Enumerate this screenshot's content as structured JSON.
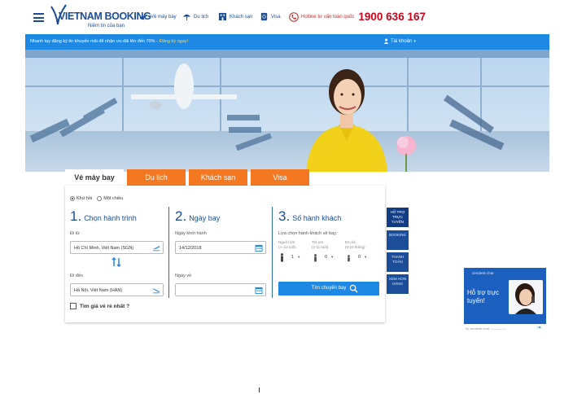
{
  "header": {
    "brand": "VIETNAM BOOKING",
    "tagline": "Niềm tin của bạn",
    "nav": [
      {
        "label": "Vé máy bay",
        "icon": "plane-icon"
      },
      {
        "label": "Du lịch",
        "icon": "beach-umbrella-icon"
      },
      {
        "label": "Khách sạn",
        "icon": "hotel-icon"
      },
      {
        "label": "Visa",
        "icon": "passport-icon"
      }
    ],
    "hotline_label": "Hotline tư vấn toàn quốc",
    "hotline_number": "1900 636 167"
  },
  "promo": {
    "message": "Nhanh tay đăng ký tin khuyến mãi để nhận ưu đãi lên đến 70% -",
    "link": "Đăng ký ngay!",
    "account": "Tài khoản"
  },
  "tabs": [
    {
      "label": "Vé máy bay",
      "active": true
    },
    {
      "label": "Du lịch",
      "active": false
    },
    {
      "label": "Khách sạn",
      "active": false
    },
    {
      "label": "Visa",
      "active": false
    }
  ],
  "trip_type": {
    "options": [
      "Khứ hồi",
      "Một chiều"
    ],
    "selected": "Khứ hồi"
  },
  "step1": {
    "number": "1.",
    "title": "Chọn hành trình",
    "from_label": "Đi từ",
    "from_value": "Hồ Chí Minh, Việt Nam (SGN)",
    "to_label": "Đi đến",
    "to_value": "Hà Nội, Việt Nam (HAN)"
  },
  "step2": {
    "number": "2.",
    "title": "Ngày bay",
    "depart_label": "Ngày khởi hành",
    "depart_value": "14/12/2018",
    "return_label": "Ngày về",
    "return_value": ""
  },
  "step3": {
    "number": "3.",
    "title": "Số hành khách",
    "prompt": "Lựa chọn hành khách sẽ bay:",
    "passengers": [
      {
        "label": "Người lớn",
        "sub": "(>=12 tuổi)",
        "count": "1"
      },
      {
        "label": "Trẻ em",
        "sub": "(2-11 tuổi)",
        "count": "0"
      },
      {
        "label": "Em bé",
        "sub": "(0-23 tháng)",
        "count": "0"
      }
    ],
    "search_label": "Tìm chuyến bay"
  },
  "cheapest_label": "Tìm giá vé rẻ nhất ?",
  "side_tabs": [
    {
      "label": "HỖ TRỢ TRỰC TUYẾN",
      "active": true
    },
    {
      "label": "BOOKING",
      "active": false
    },
    {
      "label": "THANH TOÁN",
      "active": false
    },
    {
      "label": "XEM HƠN HÀNG",
      "active": false
    }
  ],
  "chat": {
    "brand": "zendesk chat",
    "title_line1": "Hỗ trợ trực",
    "title_line2": "tuyến!",
    "footer": "by zendesk chat —————"
  },
  "colors": {
    "brand_blue": "#1b4d99",
    "accent_blue": "#1e88e5",
    "tab_orange": "#f47722",
    "hotline_red": "#d0021b"
  }
}
